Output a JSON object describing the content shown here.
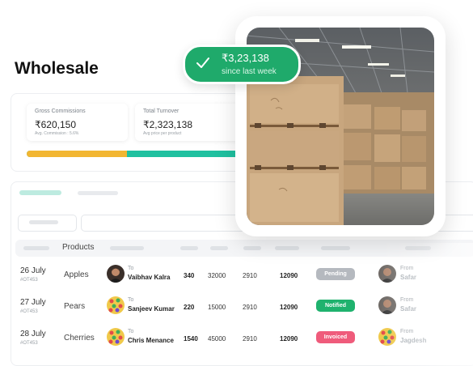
{
  "page_title": "Wholesale",
  "stats": [
    {
      "label": "Gross Commissions",
      "value": "₹620,150",
      "sub": "Avg. Commission : 5.6%"
    },
    {
      "label": "Total Turnover",
      "value": "₹2,323,138",
      "sub": "Avg price per product"
    }
  ],
  "progress": {
    "value_fraction": 0.31,
    "colors": {
      "fill": "#f2b632",
      "rest": "#20c1a0"
    }
  },
  "toast": {
    "amount": "₹3,23,138",
    "caption": "since last week",
    "color": "#1faa6b",
    "icon": "check-icon"
  },
  "table": {
    "header": {
      "products": "Products"
    },
    "to_label": "To",
    "from_label": "From",
    "rows": [
      {
        "date": "26 July",
        "order_id": "#OT453",
        "product": "Apples",
        "to": "Vaibhav Kalra",
        "qty": "340",
        "v1": "32000",
        "v2": "2910",
        "v3": "12090",
        "status": "Pending",
        "status_color": "#b5b9bf",
        "from": "Safar"
      },
      {
        "date": "27 July",
        "order_id": "#OT453",
        "product": "Pears",
        "to": "Sanjeev Kumar",
        "qty": "220",
        "v1": "15000",
        "v2": "2910",
        "v3": "12090",
        "status": "Notified",
        "status_color": "#1fb26e",
        "from": "Safar"
      },
      {
        "date": "28 July",
        "order_id": "#OT453",
        "product": "Cherries",
        "to": "Chris Menance",
        "qty": "1540",
        "v1": "45000",
        "v2": "2910",
        "v3": "12090",
        "status": "Invoiced",
        "status_color": "#ef5b7b",
        "from": "Jagdesh"
      }
    ]
  }
}
